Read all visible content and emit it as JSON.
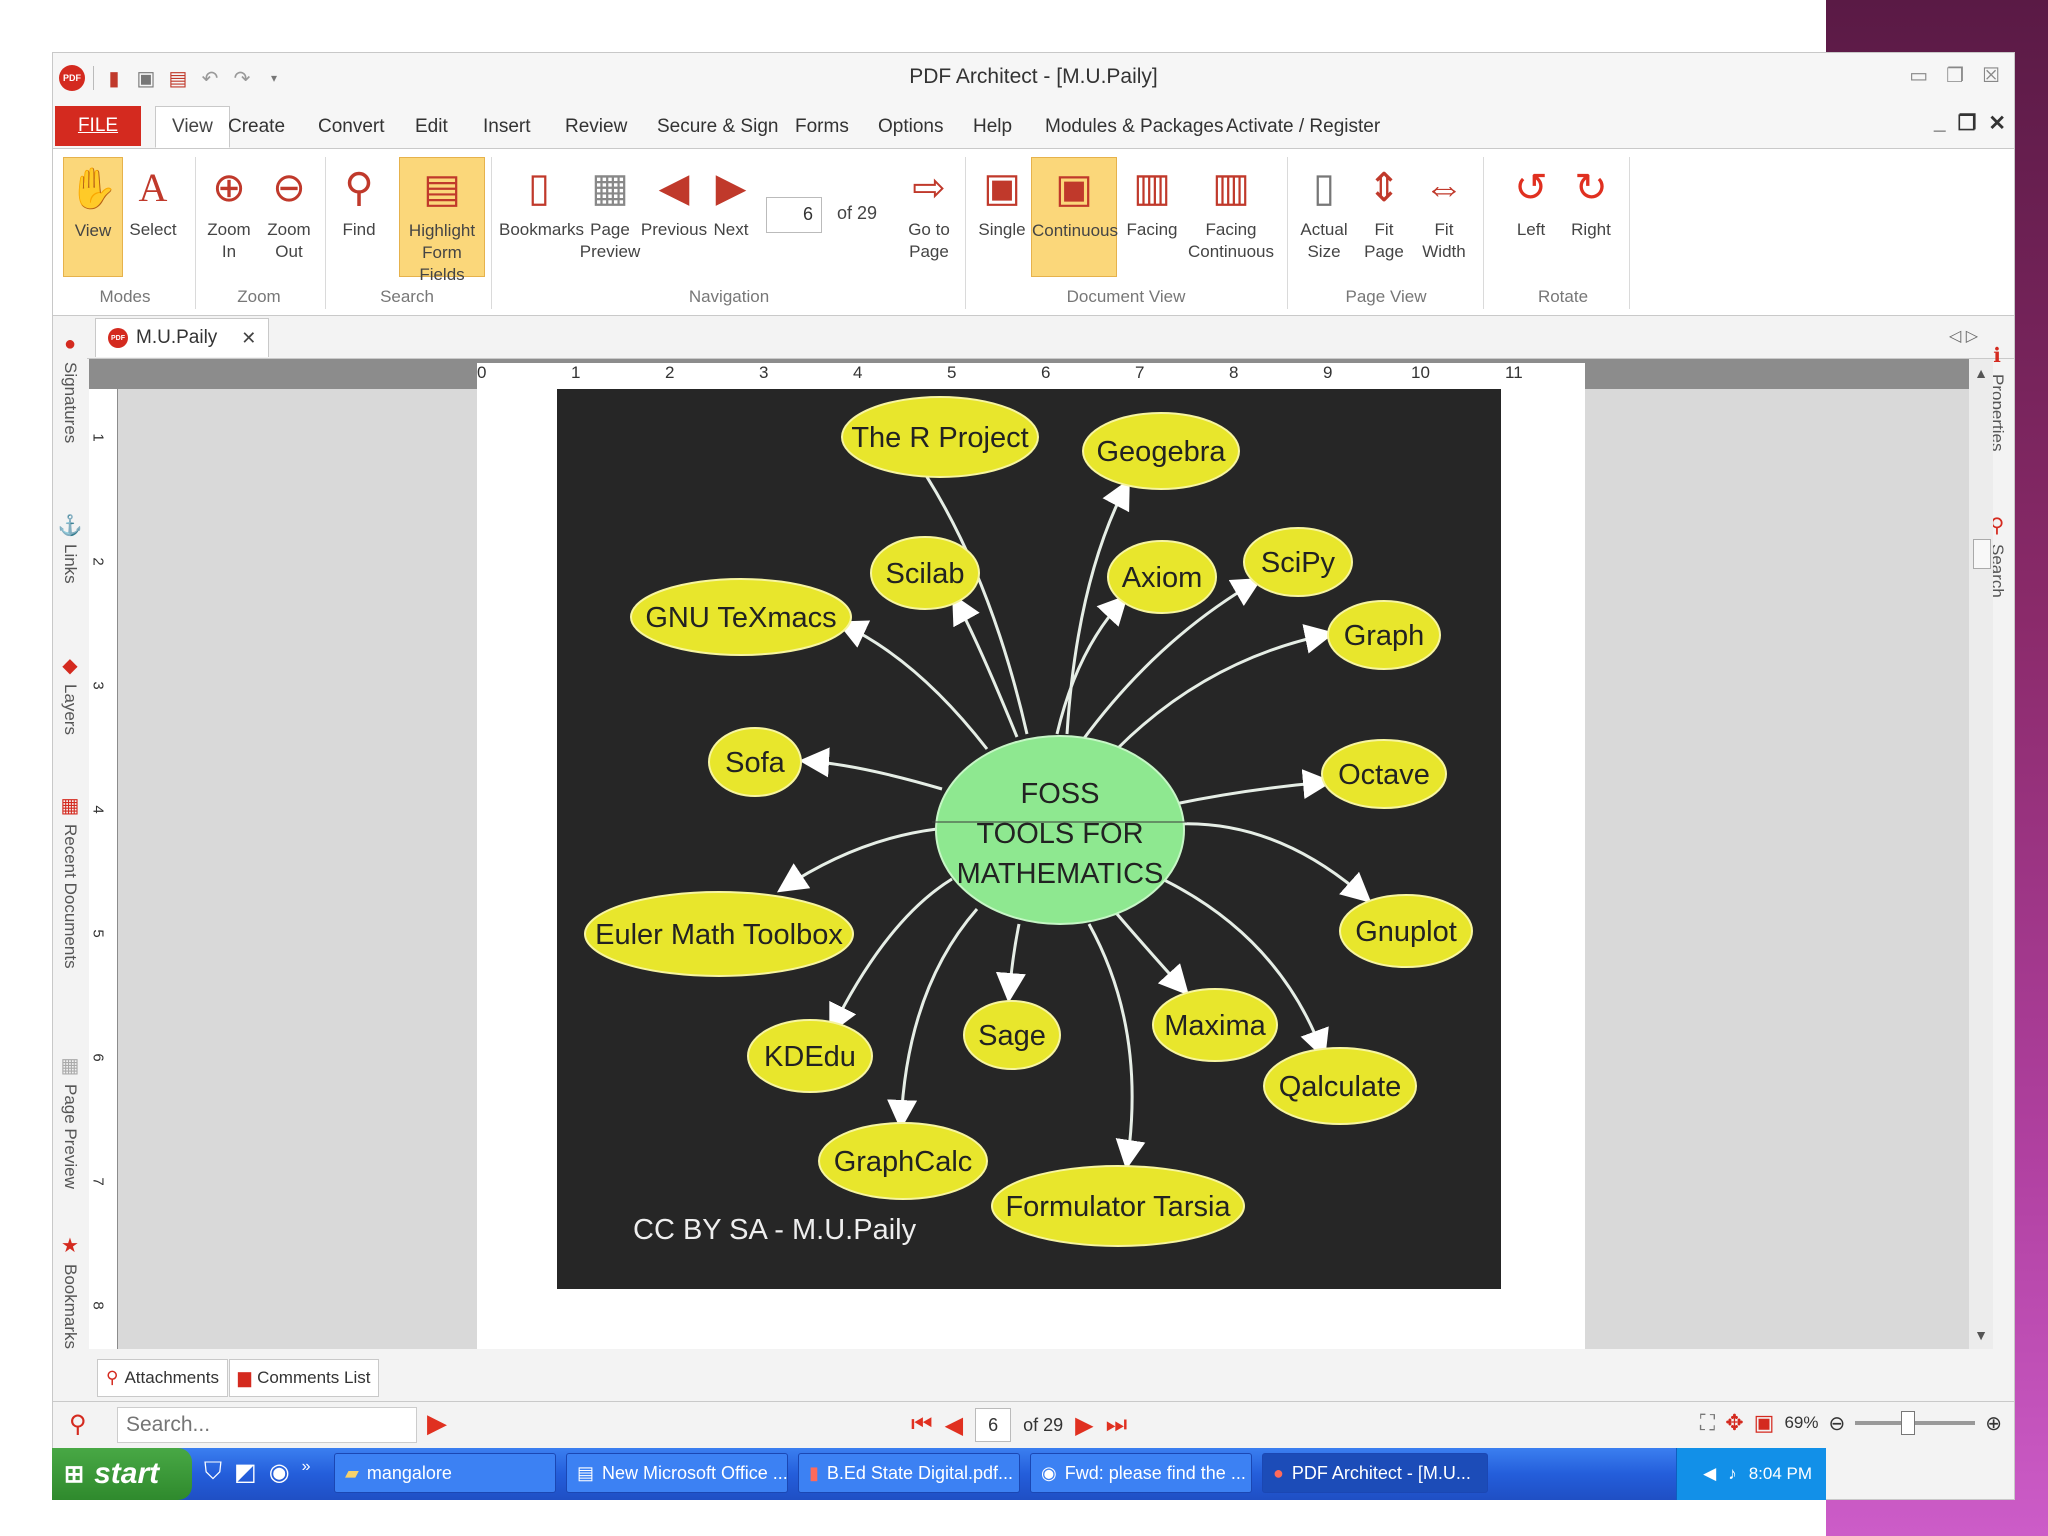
{
  "app": {
    "title": "PDF Architect  - [M.U.Paily]",
    "logo": "PDF"
  },
  "menu": {
    "file": "FILE",
    "tabs": [
      "View",
      "Create",
      "Convert",
      "Edit",
      "Insert",
      "Review",
      "Secure & Sign",
      "Forms",
      "Options",
      "Help",
      "Modules & Packages",
      "Activate / Register"
    ]
  },
  "ribbon": {
    "view": "View",
    "select": "Select",
    "zoom_in": "Zoom\nIn",
    "zoom_out": "Zoom\nOut",
    "find": "Find",
    "highlight": "Highlight\nForm Fields",
    "bookmarks": "Bookmarks",
    "page_preview": "Page\nPreview",
    "previous": "Previous",
    "next": "Next",
    "page_value": "6",
    "page_of": "of 29",
    "goto": "Go to\nPage",
    "single": "Single",
    "continuous": "Continuous",
    "facing": "Facing",
    "facing_continuous": "Facing\nContinuous",
    "actual_size": "Actual\nSize",
    "fit_page": "Fit\nPage",
    "fit_width": "Fit\nWidth",
    "left": "Left",
    "right": "Right",
    "groups": {
      "modes": "Modes",
      "zoom": "Zoom",
      "search": "Search",
      "navigation": "Navigation",
      "document_view": "Document View",
      "page_view": "Page View",
      "rotate": "Rotate"
    }
  },
  "doc_tab": "M.U.Paily",
  "left_panels": [
    "Signatures",
    "Links",
    "Layers",
    "Recent Documents",
    "Page Preview",
    "Bookmarks"
  ],
  "right_panels": [
    "Properties",
    "Search"
  ],
  "ruler": {
    "top": [
      "0",
      "1",
      "2",
      "3",
      "4",
      "5",
      "6",
      "7",
      "8",
      "9",
      "10",
      "11"
    ],
    "left": [
      "1",
      "2",
      "3",
      "4",
      "5",
      "6",
      "7",
      "8"
    ]
  },
  "diagram": {
    "center": [
      "FOSS",
      "TOOLS FOR",
      "MATHEMATICS"
    ],
    "nodes": {
      "r_project": "The R Project",
      "geogebra": "Geogebra",
      "scilab": "Scilab",
      "axiom": "Axiom",
      "scipy": "SciPy",
      "gnu_texmacs": "GNU TeXmacs",
      "graph": "Graph",
      "sofa": "Sofa",
      "octave": "Octave",
      "euler": "Euler Math Toolbox",
      "gnuplot": "Gnuplot",
      "kdedu": "KDEdu",
      "sage": "Sage",
      "maxima": "Maxima",
      "qalculate": "Qalculate",
      "graphcalc": "GraphCalc",
      "formulator": "Formulator Tarsia"
    },
    "credit": "CC BY SA - M.U.Paily",
    "colors": {
      "node": "#e8e62c",
      "center": "#8ee890",
      "background": "#262626"
    }
  },
  "bottom": {
    "attachments": "Attachments",
    "comments": "Comments List",
    "search_placeholder": "Search...",
    "page_value": "6",
    "page_of": "of 29",
    "zoom": "69%"
  },
  "taskbar": {
    "start": "start",
    "tasks": [
      "mangalore",
      "New Microsoft Office ...",
      "B.Ed State Digital.pdf...",
      "Fwd: please find the ...",
      "PDF Architect  - [M.U..."
    ],
    "clock": "8:04 PM"
  }
}
